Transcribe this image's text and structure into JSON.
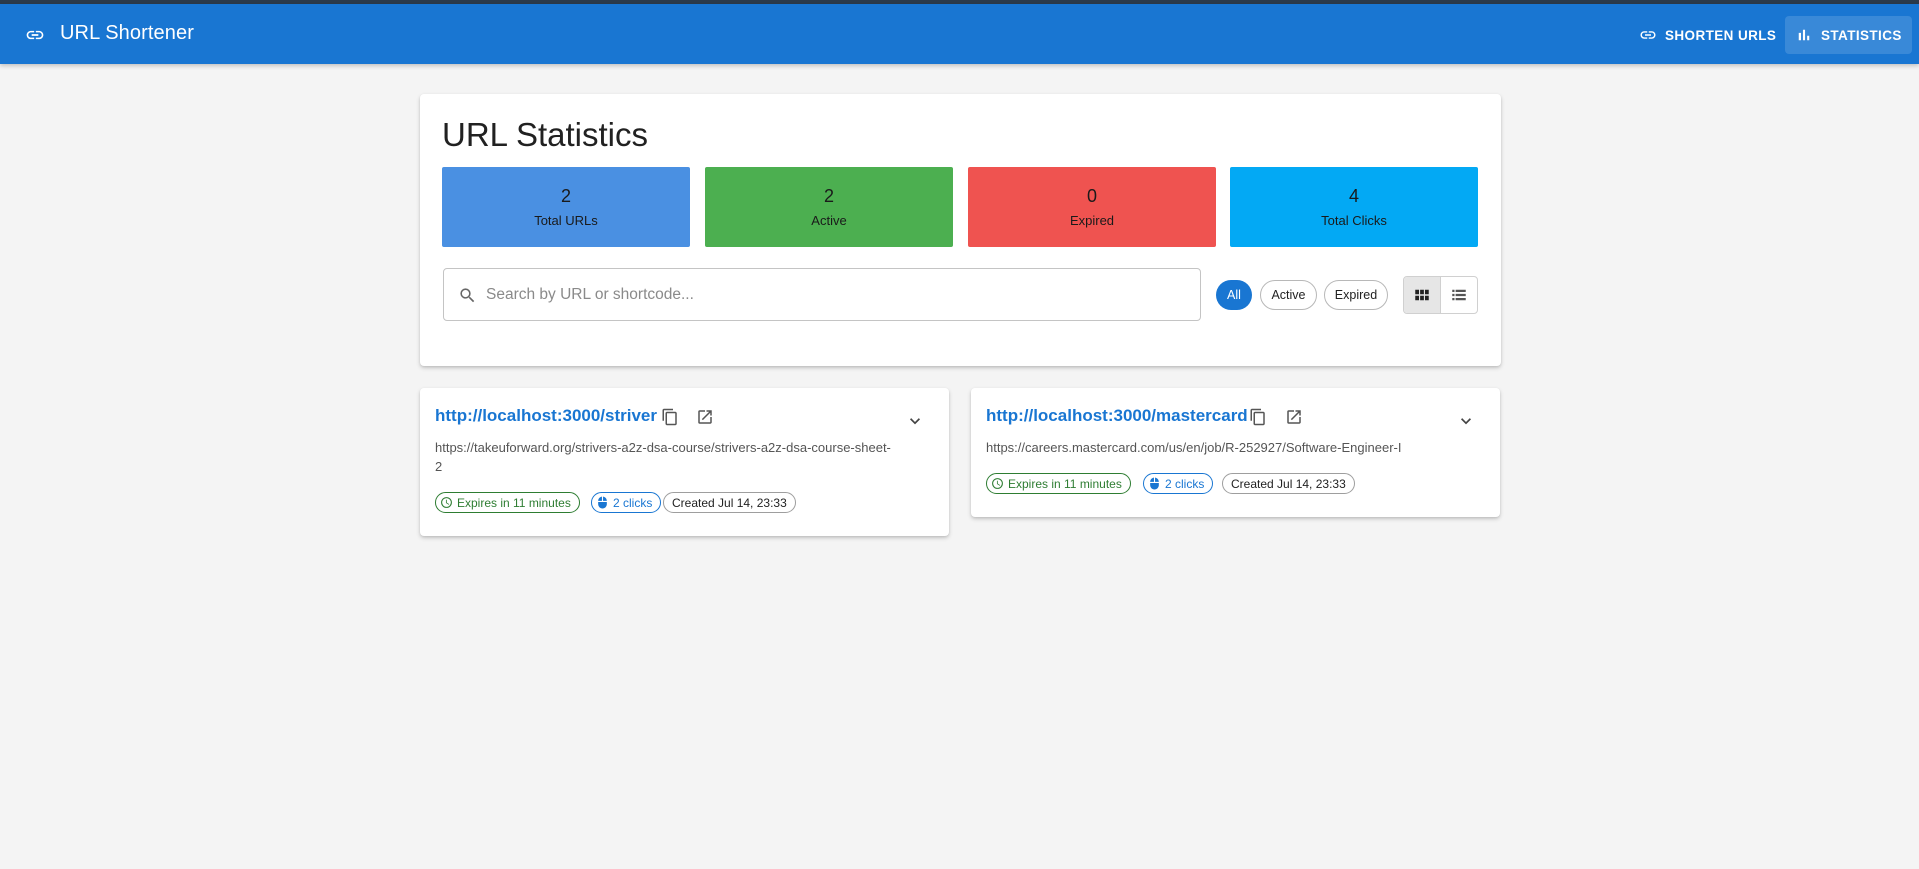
{
  "appbar": {
    "title": "URL Shortener",
    "nav": [
      {
        "label": "SHORTEN URLS",
        "icon": "link-icon"
      },
      {
        "label": "STATISTICS",
        "icon": "bar-chart-icon",
        "active": true
      }
    ],
    "color": "#1976d2"
  },
  "stats_panel": {
    "title": "URL Statistics",
    "stats": [
      {
        "value": "2",
        "label": "Total URLs",
        "color": "#4a90e2"
      },
      {
        "value": "2",
        "label": "Active",
        "color": "#4caf50"
      },
      {
        "value": "0",
        "label": "Expired",
        "color": "#ef5350"
      },
      {
        "value": "4",
        "label": "Total Clicks",
        "color": "#03a9f4"
      }
    ],
    "search": {
      "placeholder": "Search by URL or shortcode...",
      "value": ""
    },
    "filters": [
      {
        "label": "All",
        "selected": true
      },
      {
        "label": "Active",
        "selected": false
      },
      {
        "label": "Expired",
        "selected": false
      }
    ],
    "view_modes": [
      {
        "icon": "grid-view-icon",
        "selected": true
      },
      {
        "icon": "list-view-icon",
        "selected": false
      }
    ]
  },
  "cards": [
    {
      "short_url": "http://localhost:3000/striver",
      "long_url": "https://takeuforward.org/strivers-a2z-dsa-course/strivers-a2z-dsa-course-sheet-2",
      "expires": "Expires in 11 minutes",
      "clicks": "2 clicks",
      "created": "Created Jul 14, 23:33"
    },
    {
      "short_url": "http://localhost:3000/mastercard",
      "long_url": "https://careers.mastercard.com/us/en/job/R-252927/Software-Engineer-I",
      "expires": "Expires in 11 minutes",
      "clicks": "2 clicks",
      "created": "Created Jul 14, 23:33"
    }
  ]
}
